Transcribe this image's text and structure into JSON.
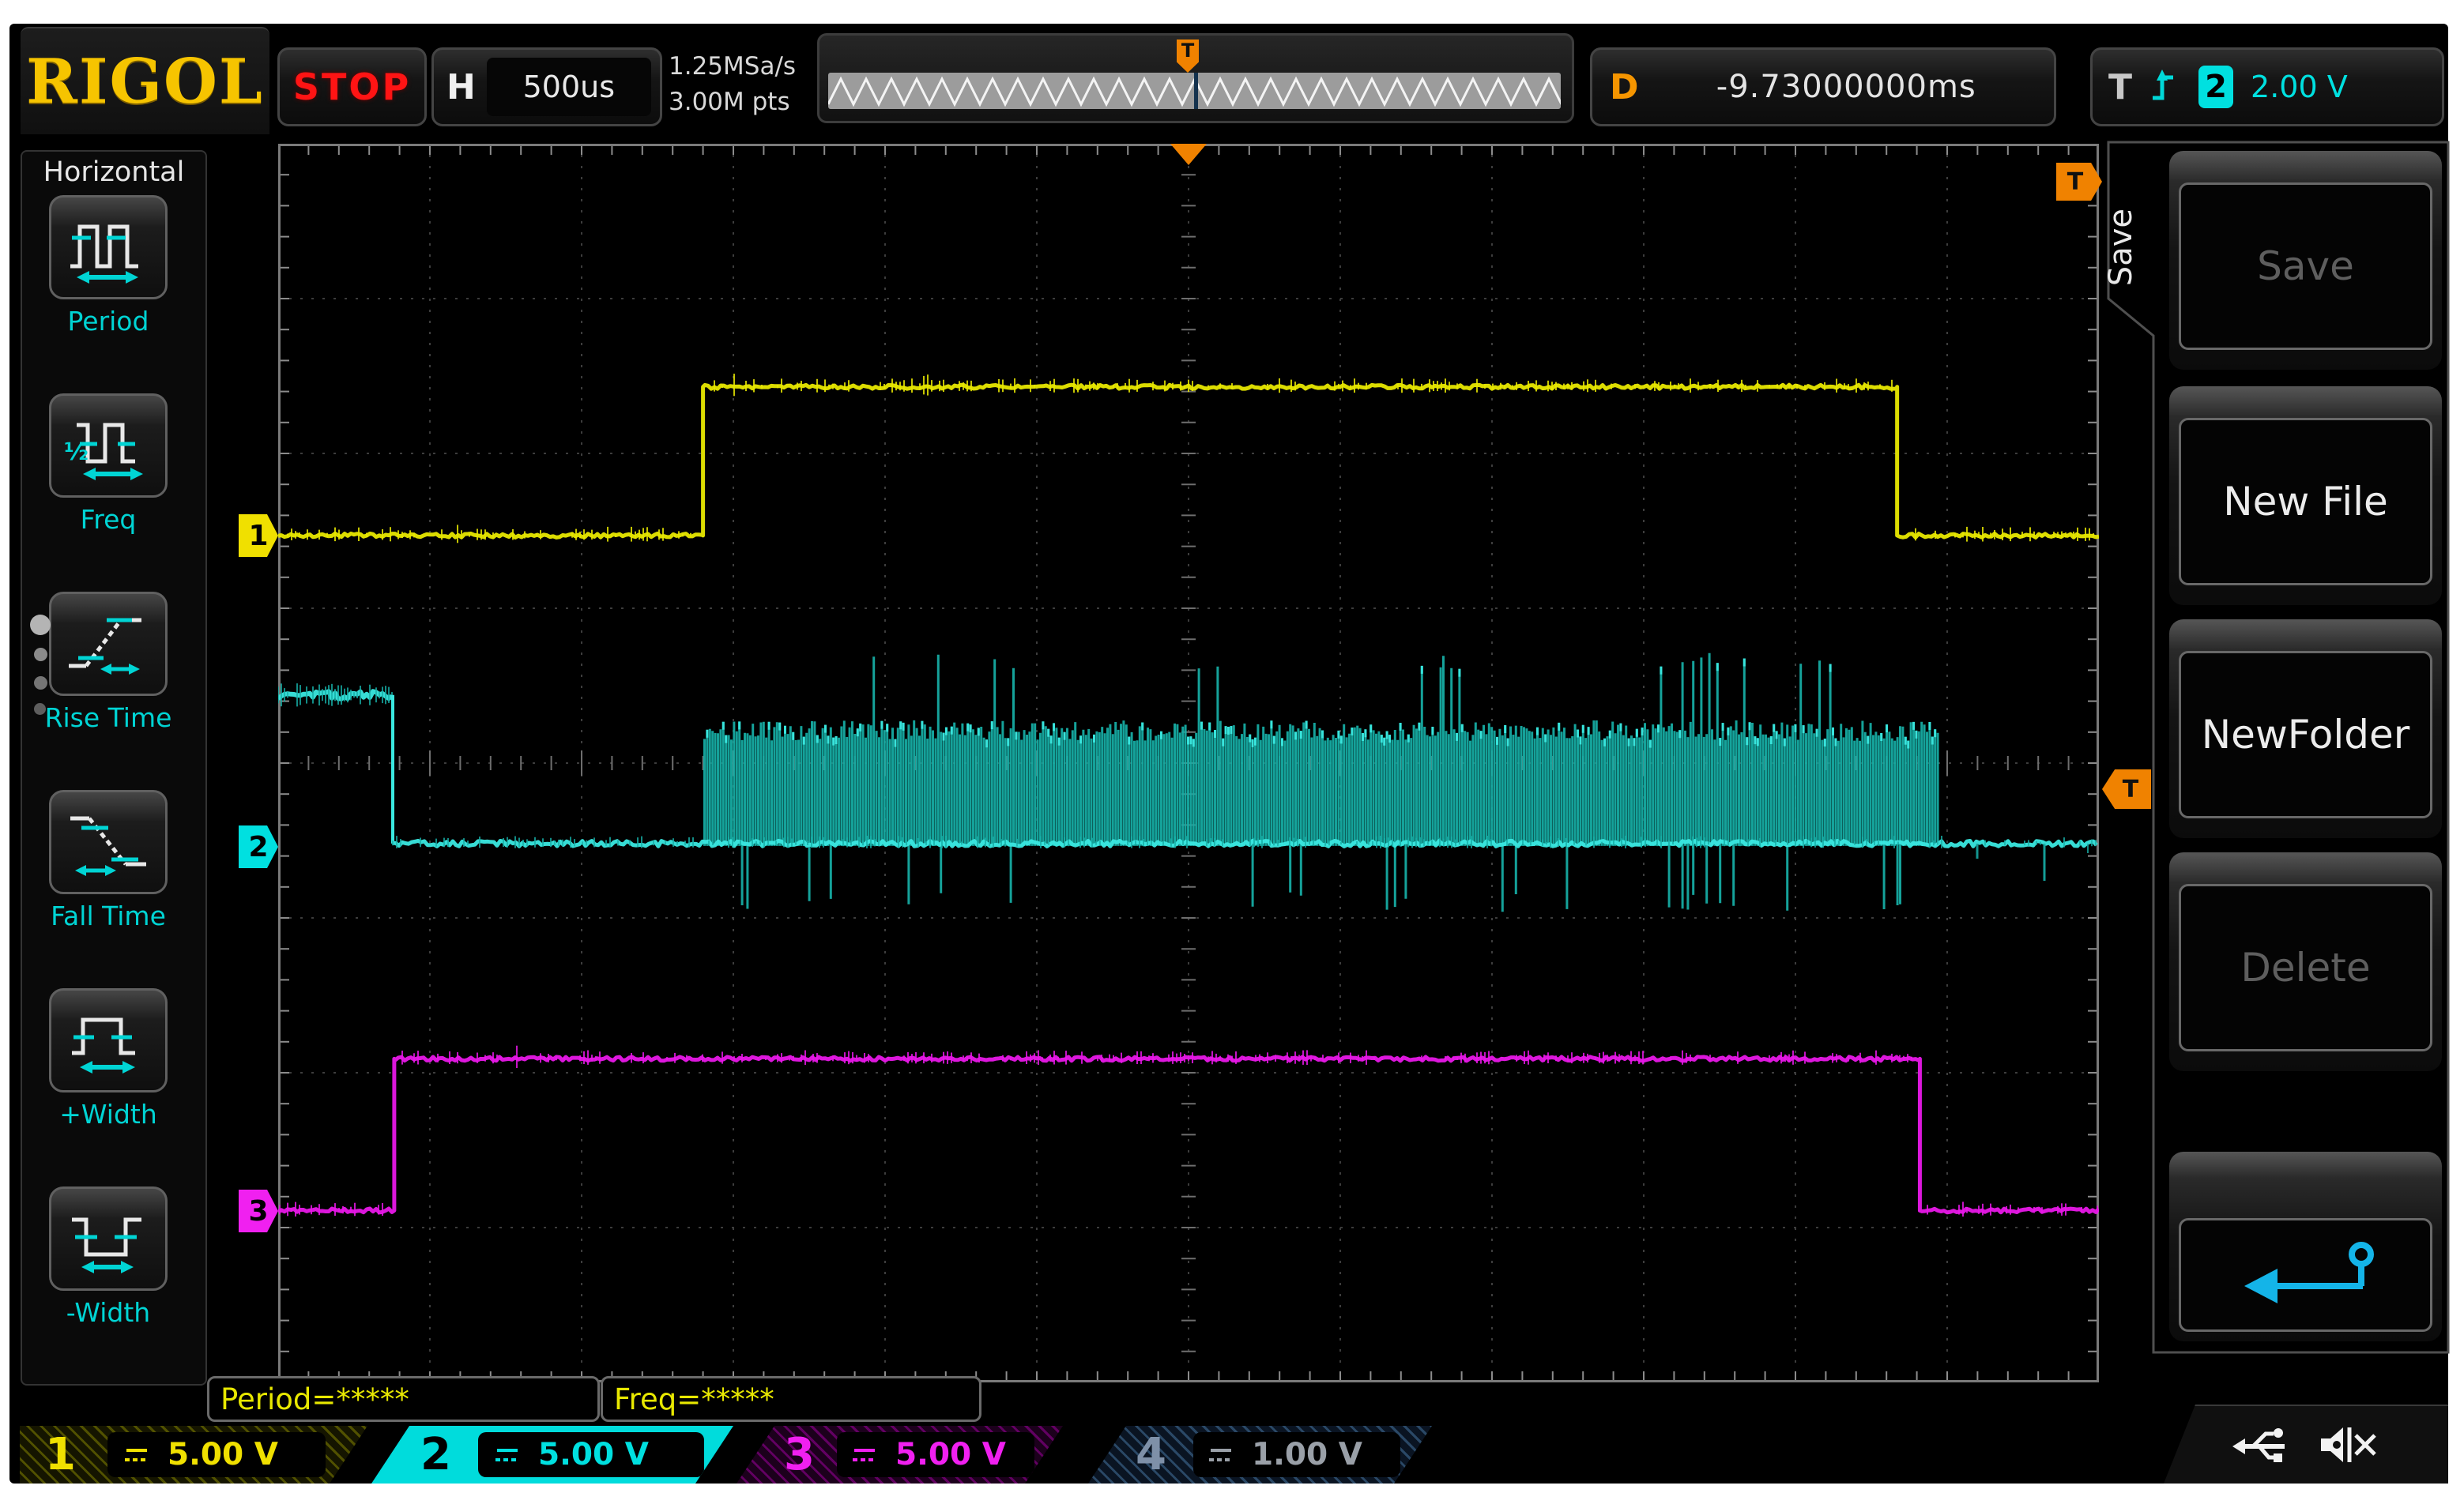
{
  "top_bar": {
    "brand": "RIGOL",
    "status": "STOP",
    "h_label": "H",
    "timebase": "500us",
    "sample_rate": "1.25MSa/s",
    "memory_depth": "3.00M pts",
    "d_label": "D",
    "d_value": "-9.73000000ms",
    "t_label": "T",
    "trigger_source_channel": "2",
    "trigger_level": "2.00 V",
    "trigger_edge_icon": "rising-edge-icon",
    "trigger_position_marker": "T"
  },
  "left_sidebar": {
    "title": "Horizontal",
    "items": [
      {
        "label": "Period",
        "icon": "period-icon"
      },
      {
        "label": "Freq",
        "icon": "freq-icon"
      },
      {
        "label": "Rise Time",
        "icon": "rise-time-icon"
      },
      {
        "label": "Fall Time",
        "icon": "fall-time-icon"
      },
      {
        "label": "+Width",
        "icon": "plus-width-icon"
      },
      {
        "label": "-Width",
        "icon": "minus-width-icon"
      }
    ]
  },
  "right_menu": {
    "tab_label": "Save",
    "buttons": [
      {
        "label": "Save",
        "enabled": false
      },
      {
        "label": "New File",
        "enabled": true
      },
      {
        "label": "NewFolder",
        "enabled": true
      },
      {
        "label": "Delete",
        "enabled": false
      },
      {
        "label": "",
        "enabled": true,
        "icon": "back-arrow-icon"
      }
    ]
  },
  "measurements": [
    {
      "label": "Period=*****"
    },
    {
      "label": "Freq=*****"
    }
  ],
  "channels": [
    {
      "number": "1",
      "scale": "5.00 V",
      "coupling": "DC",
      "color": "#f0e000",
      "selected": false,
      "enabled": true
    },
    {
      "number": "2",
      "scale": "5.00 V",
      "coupling": "DC",
      "color": "#00e0e0",
      "selected": true,
      "enabled": true
    },
    {
      "number": "3",
      "scale": "5.00 V",
      "coupling": "DC",
      "color": "#f020f0",
      "selected": false,
      "enabled": true
    },
    {
      "number": "4",
      "scale": "1.00 V",
      "coupling": "DC",
      "color": "#8094aa",
      "selected": false,
      "enabled": false
    }
  ],
  "status_icons": [
    "usb-icon",
    "speaker-muted-icon"
  ],
  "scope": {
    "grid": {
      "h_divs": 12,
      "v_divs": 8
    },
    "trigger": {
      "position_x_div": 6.0,
      "level_y_div": 4.17
    },
    "waveforms": [
      {
        "name": "CH1",
        "color": "#e8e800",
        "type": "pulse",
        "ground_y_div": 2.53,
        "low_y_div": 2.53,
        "high_y_div": 1.57,
        "rise_x_div": 2.8,
        "fall_x_div": 10.67
      },
      {
        "name": "CH2",
        "color": "#17b0a8",
        "bright": "#3ae8e0",
        "type": "burst",
        "ground_y_div": 4.52,
        "idle_high_y_div": 3.56,
        "idle_end_x_div": 0.755,
        "base_y_div": 4.52,
        "burst_start_x_div": 2.81,
        "burst_end_x_div": 10.95,
        "band_top_y_div": 3.79,
        "spike_top_y_div": 3.4,
        "spike_bot_y_div": 4.82
      },
      {
        "name": "CH3",
        "color": "#e818e8",
        "type": "pulse",
        "ground_y_div": 6.89,
        "low_y_div": 6.89,
        "high_y_div": 5.91,
        "rise_x_div": 0.765,
        "fall_x_div": 10.82
      }
    ]
  }
}
